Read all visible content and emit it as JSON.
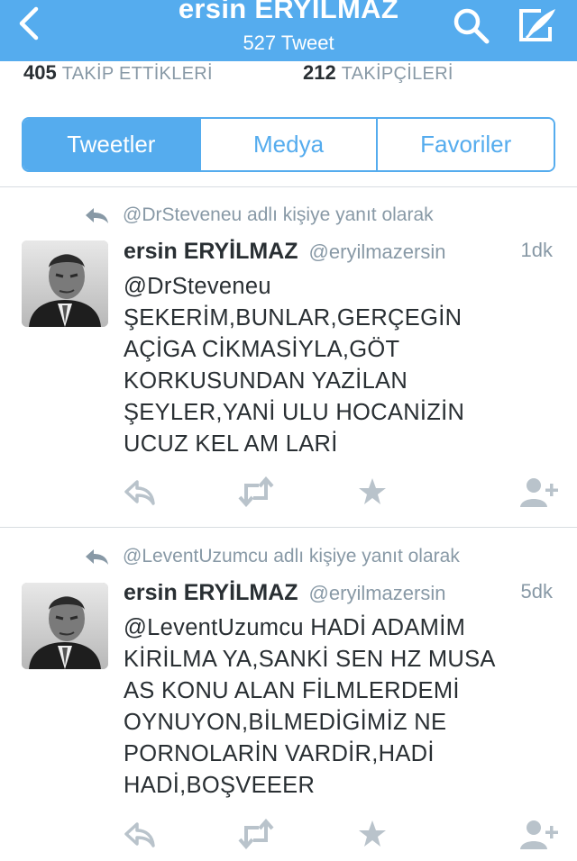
{
  "header": {
    "name": "ersin ERYİLMAZ",
    "tweet_count": "527 Tweet",
    "bg_color": "#55acee"
  },
  "stats": {
    "following_count": "405",
    "following_label": "TAKİP ETTİKLERİ",
    "followers_count": "212",
    "followers_label": "TAKİPÇİLERİ"
  },
  "tabs": [
    {
      "label": "Tweetler",
      "active": true
    },
    {
      "label": "Medya",
      "active": false
    },
    {
      "label": "Favoriler",
      "active": false
    }
  ],
  "tweets": [
    {
      "reply_context": "@DrSteveneu adlı kişiye yanıt olarak",
      "name": "ersin ERYİLMAZ",
      "handle": "@eryilmazersin",
      "time": "1dk",
      "text_lines": [
        "@DrSteveneu",
        "ŞEKERİM,BUNLAR,GERÇEGİN",
        "AÇİGA CİKMASİYLA,GÖT",
        "KORKUSUNDAN YAZİLAN",
        "ŞEYLER,YANİ ULU HOCANİZİN",
        "UCUZ KEL AM LARİ"
      ]
    },
    {
      "reply_context": "@LeventUzumcu adlı kişiye yanıt olarak",
      "name": "ersin ERYİLMAZ",
      "handle": "@eryilmazersin",
      "time": "5dk",
      "text_lines": [
        "@LeventUzumcu HADİ ADAMİM",
        "KİRİLMA YA,SANKİ SEN HZ MUSA",
        "AS KONU ALAN FİLMLERDEMİ",
        "OYNUYON,BİLMEDİGİMİZ NE",
        "PORNOLARİN VARDİR,HADİ",
        "HADİ,BOŞVEEER"
      ]
    }
  ],
  "icons": {
    "back": "chevron-left-icon",
    "search": "search-icon",
    "compose": "compose-icon",
    "reply": "reply-icon",
    "retweet": "retweet-icon",
    "favorite": "star-icon",
    "follow": "add-user-icon"
  }
}
